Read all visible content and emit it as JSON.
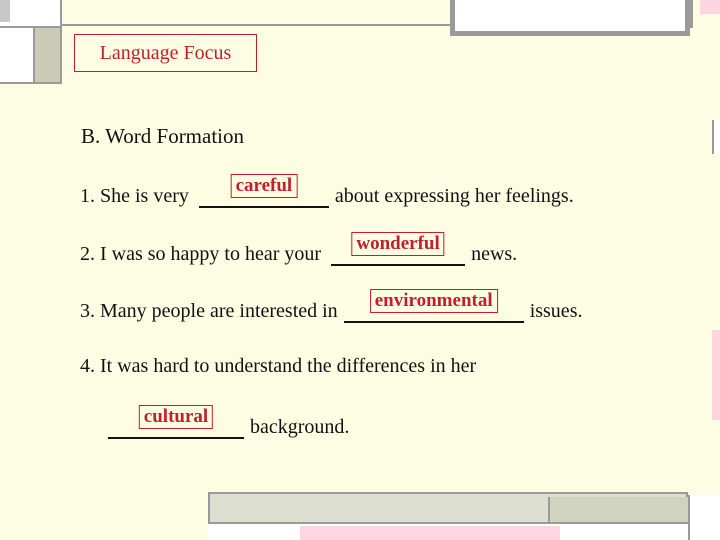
{
  "slide": {
    "title": "Language Focus",
    "heading": "B. Word Formation"
  },
  "items": [
    {
      "before": "1. She is very",
      "answer": "careful",
      "after": "about expressing her feelings."
    },
    {
      "before": "2. I was so happy to hear your",
      "answer": "wonderful",
      "after": "news."
    },
    {
      "before": "3. Many people are interested in",
      "answer": "environmental",
      "after": "issues."
    },
    {
      "line1": "4. It was hard to understand the differences in her",
      "answer": "cultural",
      "after": "background."
    }
  ],
  "colors": {
    "accent": "#c0202c",
    "background": "#fdfde4",
    "frame": "#9a9a9a",
    "pink": "#ffd6df"
  }
}
